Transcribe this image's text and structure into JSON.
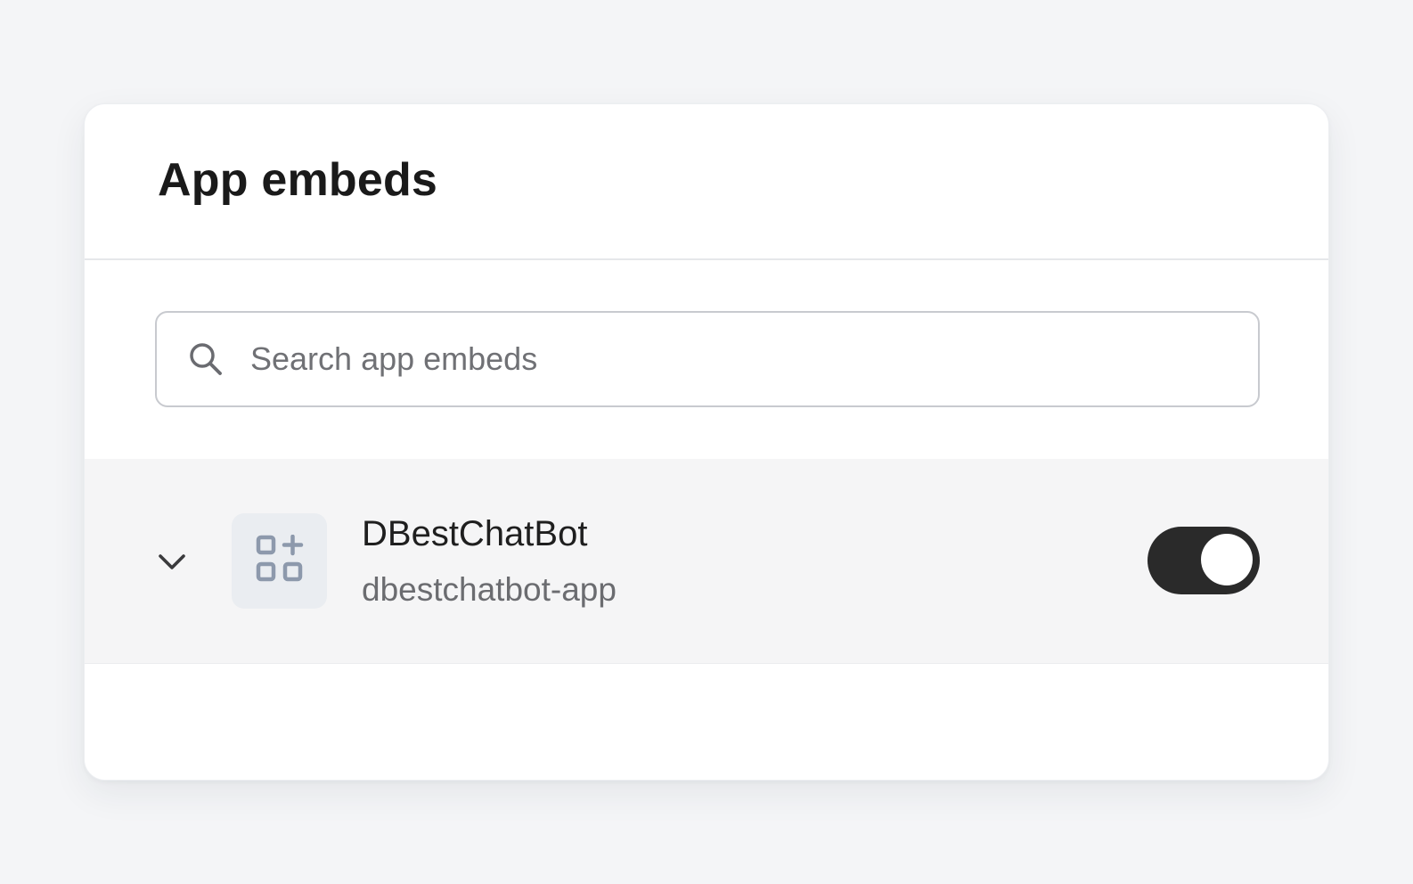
{
  "panel": {
    "title": "App embeds"
  },
  "search": {
    "placeholder": "Search app embeds",
    "value": "",
    "icon": "search-icon"
  },
  "embeds": [
    {
      "name": "DBestChatBot",
      "handle": "dbestchatbot-app",
      "icon": "apps-add-icon",
      "expanded": false,
      "enabled": true
    }
  ],
  "colors": {
    "page_background": "#f4f5f7",
    "card_background": "#ffffff",
    "row_background": "#f5f5f6",
    "toggle_on": "#2a2a2a",
    "icon_tile": "#eaedf1",
    "icon_glyph": "#8d99ac"
  }
}
